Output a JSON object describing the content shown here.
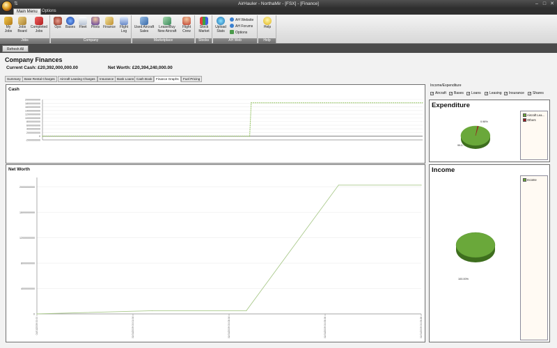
{
  "window": {
    "title": "AirHauler - NorthaMir - [FSX] - [Finance]",
    "qat": "⇅",
    "minimize": "–",
    "maximize": "□",
    "close": "✕"
  },
  "ribbon_tabs": [
    "Main Menu",
    "Options"
  ],
  "ribbon": {
    "groups": [
      {
        "label": "Jobs",
        "buttons": [
          "My\nJobs",
          "Jobs\nBoard",
          "Completed\nJobs"
        ]
      },
      {
        "label": "Company",
        "buttons": [
          "Ops",
          "Bases",
          "Fleet",
          "Pilots",
          "Finance",
          "Flight\nLog"
        ]
      },
      {
        "label": "Marketplace",
        "buttons": [
          "Used Aircraft\nSales",
          "Lease/Buy\nNew Aircraft",
          "Flight\nCrew"
        ]
      },
      {
        "label": "Stocks",
        "buttons": [
          "Stock\nMarket"
        ]
      },
      {
        "label": "AH Web",
        "buttons": [
          "Upload\nStats"
        ],
        "small": [
          "AH Website",
          "AH Forums",
          "Options"
        ]
      },
      {
        "label": "Help",
        "buttons": [
          "Help"
        ]
      }
    ]
  },
  "doc_tab": "Refresh All",
  "page": {
    "title": "Company Finances",
    "current_cash": "Current Cash: £20,392,000,000.00",
    "net_worth": "Net Worth: £20,394,240,000.00"
  },
  "subtabs": [
    "Summary",
    "Base Rental Charges",
    "Aircraft Leasing Charges",
    "Insurance",
    "Bank Loans",
    "Cash Book",
    "Finance Graphs",
    "Fuel Pricing"
  ],
  "active_subtab": "Finance Graphs",
  "income_expenditure": {
    "label": "Income/Expenditure",
    "checkboxes": [
      {
        "label": "Aircraft",
        "checked": true
      },
      {
        "label": "Bases",
        "checked": true
      },
      {
        "label": "Loans",
        "checked": true
      },
      {
        "label": "Leasing",
        "checked": true
      },
      {
        "label": "Insurance",
        "checked": true
      },
      {
        "label": "Shares",
        "checked": true
      }
    ]
  },
  "chart_data": [
    {
      "type": "line",
      "title": "Cash",
      "y_ticks": [
        "20000000000",
        "18000000000",
        "16000000000",
        "14000000000",
        "12000000000",
        "10000000000",
        "8000000000",
        "6000000000",
        "4000000000",
        "2000000000",
        "0",
        "-2000000000"
      ],
      "ylim": [
        -2000000000,
        20000000000
      ],
      "series": [
        {
          "color": "#8fc05a",
          "x": [
            0,
            0.545,
            0.549,
            1.0
          ],
          "values": [
            0,
            0,
            18200000000,
            18200000000
          ]
        }
      ]
    },
    {
      "type": "line",
      "title": "Net Worth",
      "y_ticks": [
        "20000000000",
        "16000000000",
        "12000000000",
        "8000000000",
        "4000000000",
        "0"
      ],
      "x_ticks": [
        "01/01/2009 00:00",
        "01/01/2009 00:01:04",
        "01/01/2009 00:03:04",
        "01/01/2009 00:05:06",
        "01/01/2009 00:05:26"
      ],
      "ylim": [
        0,
        21500000000
      ],
      "series": [
        {
          "color": "#a9c98a",
          "x": [
            0,
            0.3,
            0.545,
            0.785,
            1.0
          ],
          "values": [
            0,
            500000000,
            500000000,
            20300000000,
            20300000000
          ]
        }
      ]
    },
    {
      "type": "pie",
      "title": "Expenditure",
      "slices": [
        {
          "label": "Aircraft Lea...",
          "value": 99.0,
          "color": "#6aa83a",
          "text": "99.0..."
        },
        {
          "label": "Others",
          "value": 0.98,
          "color": "#9b1a20",
          "text": "0.98%"
        }
      ]
    },
    {
      "type": "pie",
      "title": "Income",
      "slices": [
        {
          "label": "Income",
          "value": 100,
          "color": "#6aa83a",
          "text": "100.00%"
        }
      ]
    }
  ],
  "colors": {
    "accent_green": "#6aa83a",
    "dark_red": "#9b1a20"
  }
}
